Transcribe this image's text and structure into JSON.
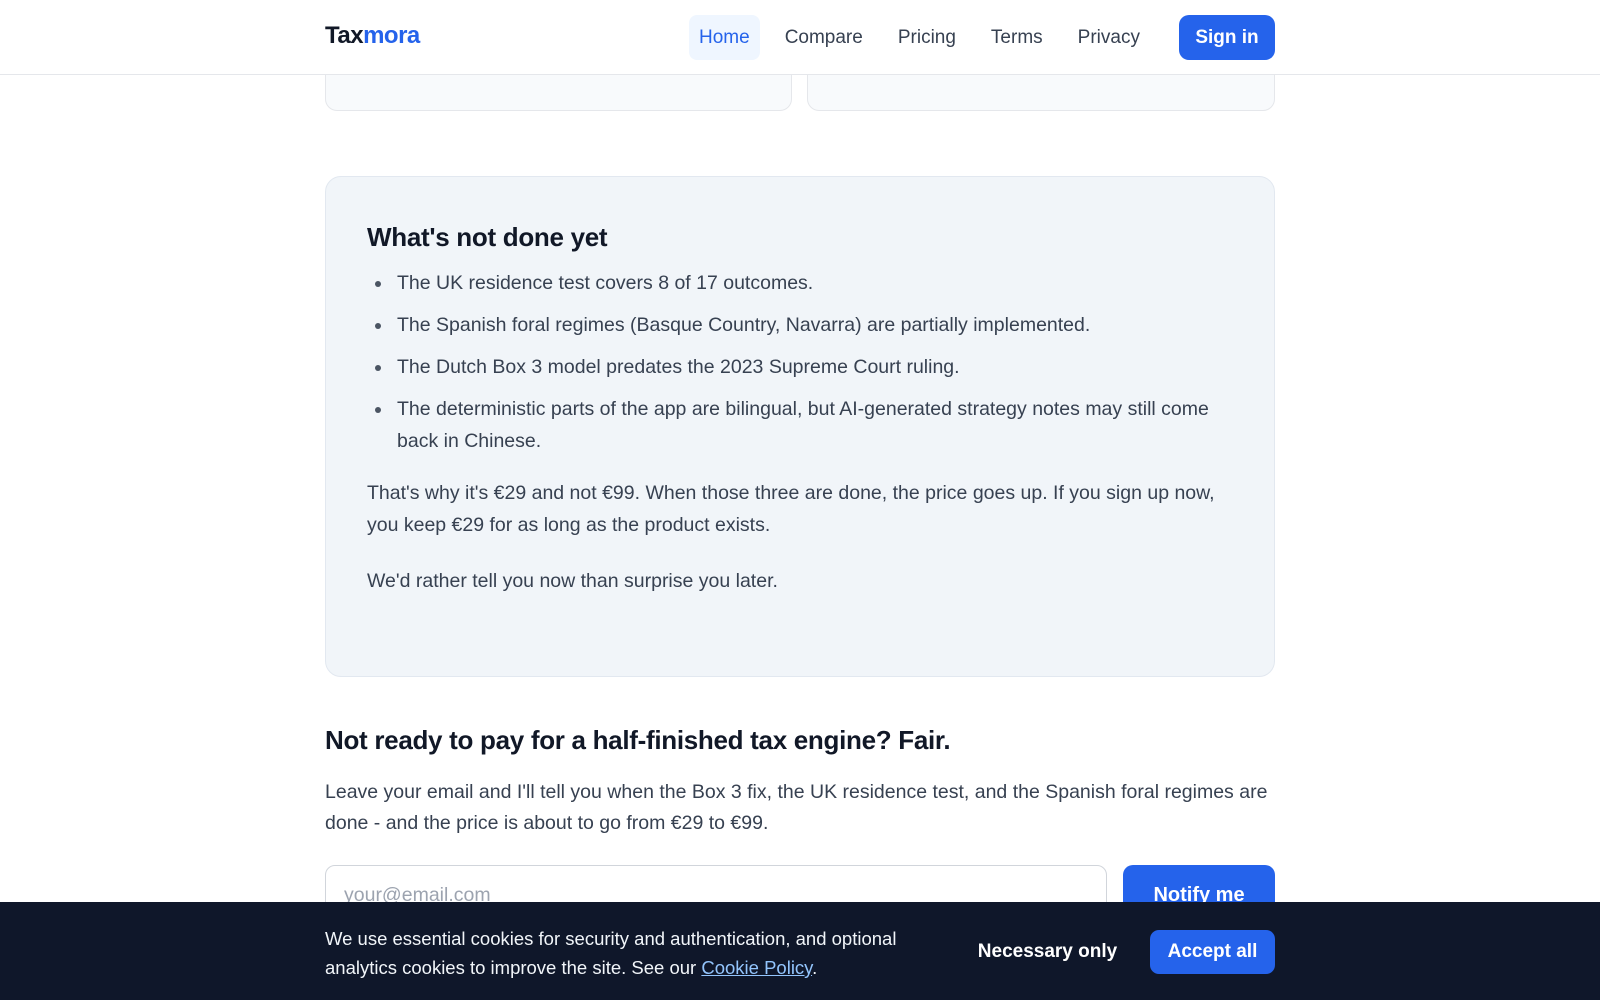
{
  "header": {
    "logo_part1": "Tax",
    "logo_part2": "mora",
    "nav": [
      {
        "label": "Home",
        "active": true
      },
      {
        "label": "Compare",
        "active": false
      },
      {
        "label": "Pricing",
        "active": false
      },
      {
        "label": "Terms",
        "active": false
      },
      {
        "label": "Privacy",
        "active": false
      }
    ],
    "signin_label": "Sign in"
  },
  "not_done": {
    "title": "What's not done yet",
    "items": [
      "The UK residence test covers 8 of 17 outcomes.",
      "The Spanish foral regimes (Basque Country, Navarra) are partially implemented.",
      "The Dutch Box 3 model predates the 2023 Supreme Court ruling.",
      "The deterministic parts of the app are bilingual, but AI-generated strategy notes may still come back in Chinese."
    ],
    "paragraph1": "That's why it's €29 and not €99. When those three are done, the price goes up. If you sign up now, you keep €29 for as long as the product exists.",
    "paragraph2": "We'd rather tell you now than surprise you later."
  },
  "waitlist": {
    "title": "Not ready to pay for a half-finished tax engine? Fair.",
    "text": "Leave your email and I'll tell you when the Box 3 fix, the UK residence test, and the Spanish foral regimes are done - and the price is about to go from €29 to €99.",
    "email_placeholder": "your@email.com",
    "email_value": "",
    "notify_label": "Notify me"
  },
  "cookie_banner": {
    "text": "We use essential cookies for security and authentication, and optional analytics cookies to improve the site. See our",
    "link_label": "Cookie Policy",
    "text_end": ".",
    "necessary_label": "Necessary only",
    "accept_label": "Accept all"
  },
  "colors": {
    "brand": "#2563eb",
    "banner_bg": "#0f172a",
    "card_bg": "#f1f5f9"
  }
}
